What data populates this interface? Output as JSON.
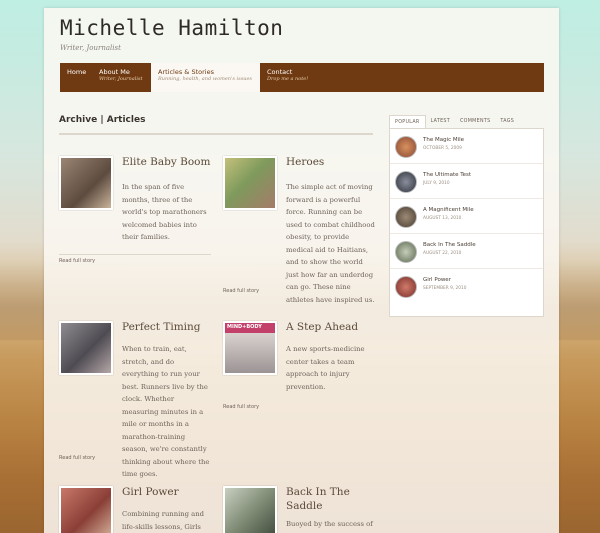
{
  "site": {
    "title": "Michelle Hamilton",
    "tagline": "Writer, Journalist"
  },
  "nav": [
    {
      "label": "Home",
      "sub": ""
    },
    {
      "label": "About Me",
      "sub": "Writer, Journalist"
    },
    {
      "label": "Articles & Stories",
      "sub": "Running, health, and women's issues"
    },
    {
      "label": "Contact",
      "sub": "Drop me a note!"
    }
  ],
  "archive": {
    "title": "Archive | Articles"
  },
  "posts": [
    {
      "title": "Elite Baby Boom",
      "body": "In the span of five months, three of the world's top marathoners welcomed babies into their families.",
      "read": "Read full story",
      "thumb_color": "#7d6a5a"
    },
    {
      "title": "Heroes",
      "body": "The simple act of moving forward is a powerful force. Running can be used to combat childhood obesity, to provide medical aid to Haitians, and to show the world just how far an underdog can go. These nine athletes have inspired us.",
      "read": "Read full story",
      "thumb_color": "#8aa06a"
    },
    {
      "title": "Perfect Timing",
      "body": "When to train, eat, stretch, and do everything to run your best. Runners live by the clock. Whether measuring minutes in a mile or months in a marathon-training season, we're constantly thinking about where the time goes.",
      "read": "Read full story",
      "thumb_color": "#6d6a6e"
    },
    {
      "title": "A Step Ahead",
      "body": "A new sports-medicine center takes a team approach to injury prevention.",
      "read": "Read full story",
      "thumb_color": "#b8a9a3",
      "thumb_text": "MIND+BODY"
    },
    {
      "title": "Girl Power",
      "body": "Combining running and life-skills lessons, Girls on",
      "read": "",
      "thumb_color": "#a8655a"
    },
    {
      "title": "Back In The Saddle",
      "body": "Buoyed by the success of",
      "read": "",
      "thumb_color": "#8f9a7c"
    }
  ],
  "sidebar": {
    "tabs": [
      "POPULAR",
      "LATEST",
      "COMMENTS",
      "TAGS"
    ],
    "items": [
      {
        "title": "The Magic Mile",
        "date": "OCTOBER 5, 2009",
        "color": "#b26a4a"
      },
      {
        "title": "The Ultimate Test",
        "date": "JULY 9, 2010",
        "color": "#4a4f5c"
      },
      {
        "title": "A Magnificent Mile",
        "date": "AUGUST 13, 2010",
        "color": "#6a5a4a"
      },
      {
        "title": "Back In The Saddle",
        "date": "AUGUST 22, 2010",
        "color": "#7d8a6c"
      },
      {
        "title": "Girl Power",
        "date": "SEPTEMBER 9, 2010",
        "color": "#a2504a"
      }
    ]
  }
}
